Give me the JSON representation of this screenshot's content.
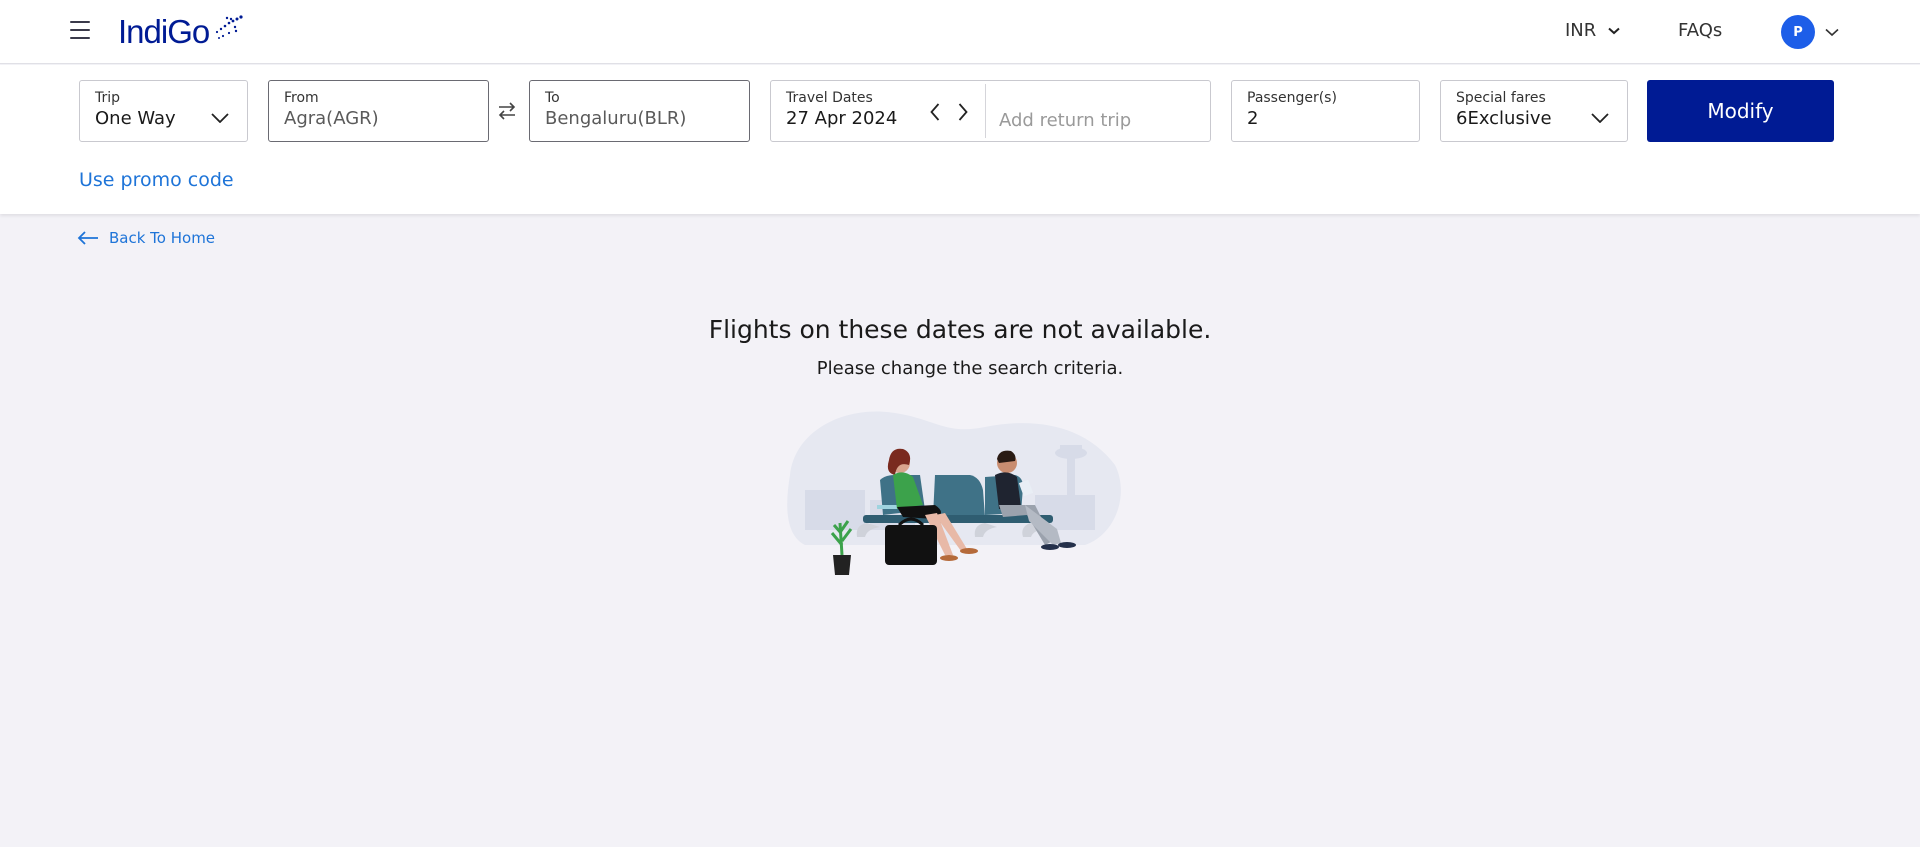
{
  "header": {
    "logo_text": "IndiGo",
    "currency": "INR",
    "faqs": "FAQs",
    "avatar_initial": "P"
  },
  "search": {
    "trip": {
      "label": "Trip",
      "value": "One Way"
    },
    "from": {
      "label": "From",
      "value": "Agra(AGR)"
    },
    "to": {
      "label": "To",
      "value": "Bengaluru(BLR)"
    },
    "dates": {
      "label": "Travel Dates",
      "value": "27 Apr 2024",
      "return_placeholder": "Add return trip"
    },
    "passengers": {
      "label": "Passenger(s)",
      "value": "2"
    },
    "special_fares": {
      "label": "Special fares",
      "value": "6Exclusive"
    },
    "modify_label": "Modify",
    "promo_label": "Use promo code"
  },
  "main": {
    "back_label": "Back To Home",
    "message_title": "Flights on these dates are not available.",
    "message_subtitle": "Please change the search criteria."
  },
  "colors": {
    "brand": "#001b94",
    "link": "#1e74d8",
    "avatar": "#1d5ee8",
    "page_bg": "#f3f2f7"
  }
}
